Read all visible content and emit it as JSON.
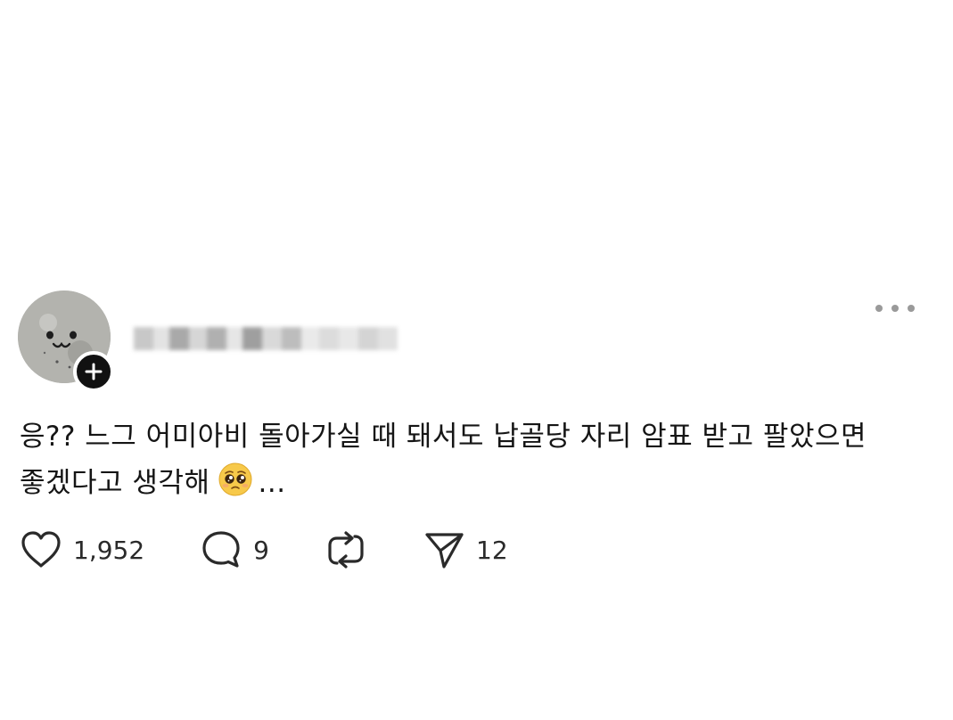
{
  "post": {
    "author_name_redacted": true,
    "body_line1": "응?? 느그 어미아비 돌아가실 때 돼서도 납골당 자리 암표 받고 팔았으면",
    "body_line2": "좋겠다고 생각해",
    "body_emoji": "pleading-face-emoji",
    "body_ellipsis": "...",
    "likes": "1,952",
    "replies": "9",
    "shares": "12"
  },
  "icons": {
    "follow": "plus-icon",
    "more": "more-horizontal-icon",
    "like": "heart-icon",
    "reply": "comment-icon",
    "repost": "repost-icon",
    "share": "send-icon"
  },
  "colors": {
    "text": "#151515",
    "badge": "#111111",
    "muted": "#9a9a9a"
  }
}
